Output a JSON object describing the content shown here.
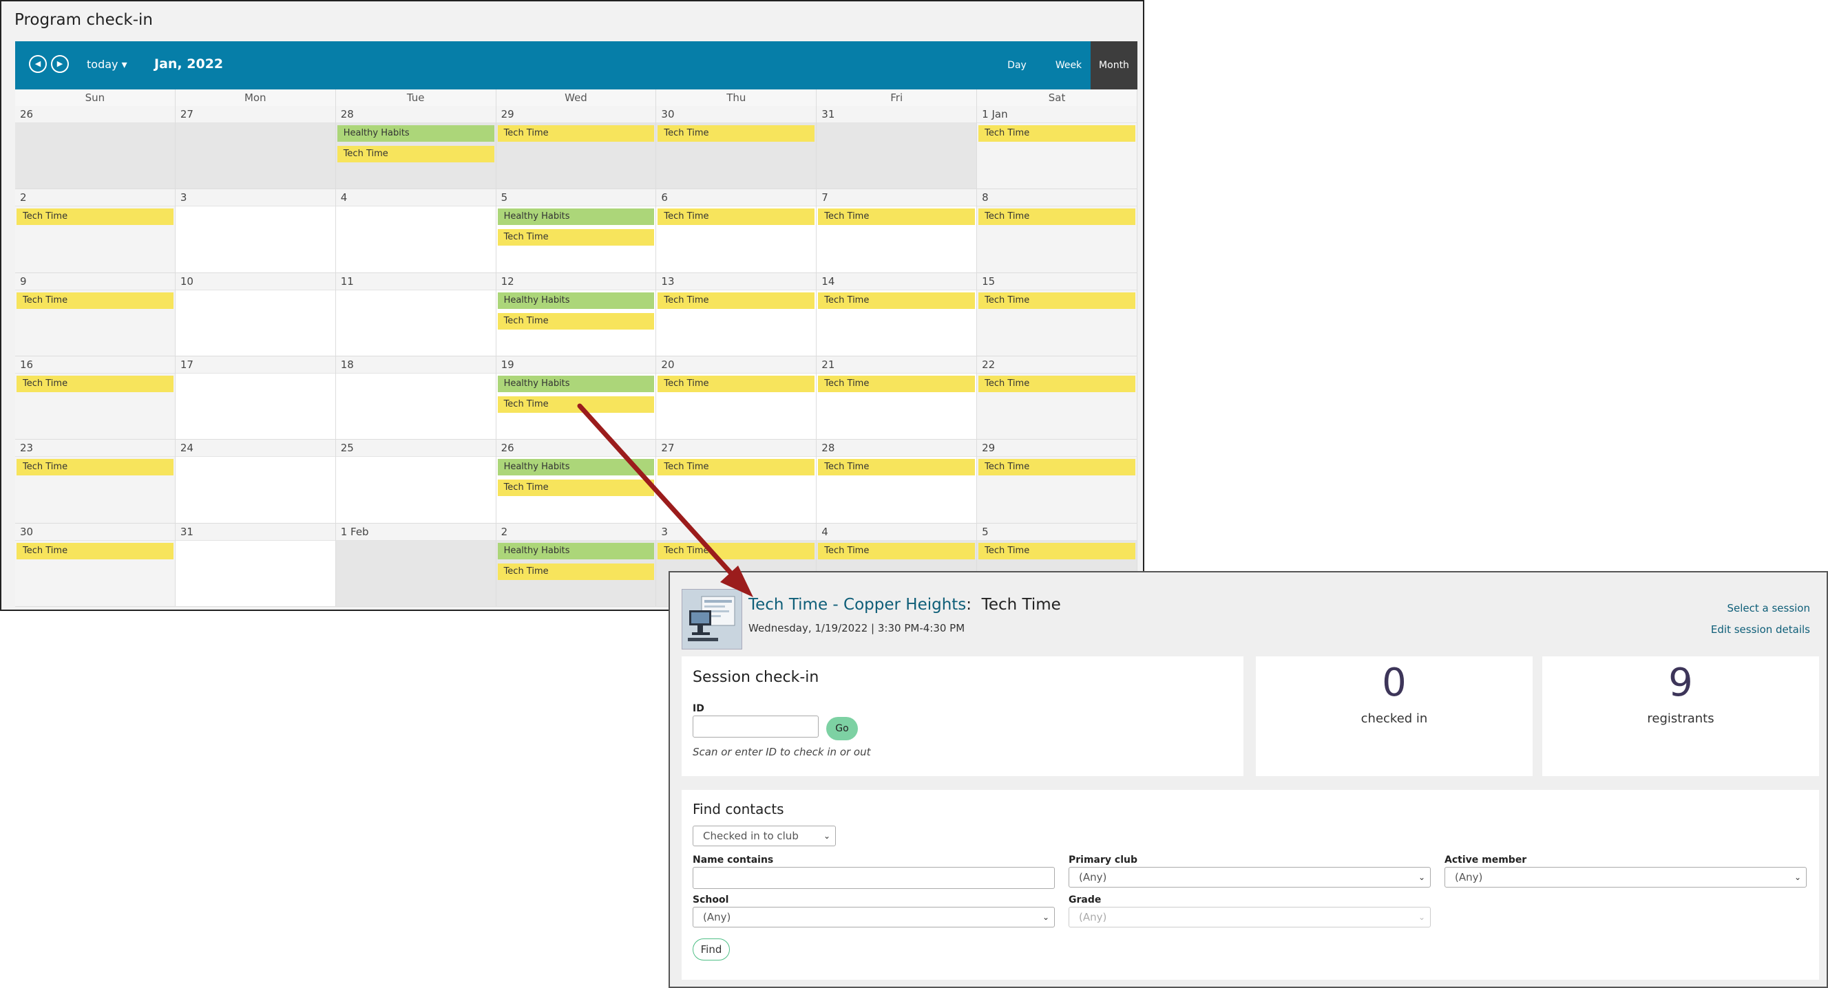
{
  "calendar": {
    "title": "Program check-in",
    "prev_icon": "◀",
    "next_icon": "▶",
    "today_label": "today ▾",
    "month_label": "Jan, 2022",
    "views": {
      "day": "Day",
      "week": "Week",
      "month": "Month"
    },
    "weekdays": [
      "Sun",
      "Mon",
      "Tue",
      "Wed",
      "Thu",
      "Fri",
      "Sat"
    ],
    "weeks": [
      [
        {
          "date": "26",
          "shade": "grey",
          "events": []
        },
        {
          "date": "27",
          "shade": "grey",
          "events": []
        },
        {
          "date": "28",
          "shade": "grey",
          "events": [
            {
              "name": "Healthy Habits",
              "color": "green"
            },
            {
              "name": "Tech Time",
              "color": "yellow"
            }
          ]
        },
        {
          "date": "29",
          "shade": "grey",
          "events": [
            {
              "name": "Tech Time",
              "color": "yellow"
            }
          ]
        },
        {
          "date": "30",
          "shade": "grey",
          "events": [
            {
              "name": "Tech Time",
              "color": "yellow"
            }
          ]
        },
        {
          "date": "31",
          "shade": "grey",
          "events": []
        },
        {
          "date": "1 Jan",
          "shade": "light",
          "events": [
            {
              "name": "Tech Time",
              "color": "yellow"
            }
          ]
        }
      ],
      [
        {
          "date": "2",
          "shade": "light",
          "events": [
            {
              "name": "Tech Time",
              "color": "yellow"
            }
          ]
        },
        {
          "date": "3",
          "shade": "white",
          "events": []
        },
        {
          "date": "4",
          "shade": "white",
          "events": []
        },
        {
          "date": "5",
          "shade": "white",
          "events": [
            {
              "name": "Healthy Habits",
              "color": "green"
            },
            {
              "name": "Tech Time",
              "color": "yellow"
            }
          ]
        },
        {
          "date": "6",
          "shade": "white",
          "events": [
            {
              "name": "Tech Time",
              "color": "yellow"
            }
          ]
        },
        {
          "date": "7",
          "shade": "white",
          "events": [
            {
              "name": "Tech Time",
              "color": "yellow"
            }
          ]
        },
        {
          "date": "8",
          "shade": "light",
          "events": [
            {
              "name": "Tech Time",
              "color": "yellow"
            }
          ]
        }
      ],
      [
        {
          "date": "9",
          "shade": "light",
          "events": [
            {
              "name": "Tech Time",
              "color": "yellow"
            }
          ]
        },
        {
          "date": "10",
          "shade": "white",
          "events": []
        },
        {
          "date": "11",
          "shade": "white",
          "events": []
        },
        {
          "date": "12",
          "shade": "white",
          "events": [
            {
              "name": "Healthy Habits",
              "color": "green"
            },
            {
              "name": "Tech Time",
              "color": "yellow"
            }
          ]
        },
        {
          "date": "13",
          "shade": "white",
          "events": [
            {
              "name": "Tech Time",
              "color": "yellow"
            }
          ]
        },
        {
          "date": "14",
          "shade": "white",
          "events": [
            {
              "name": "Tech Time",
              "color": "yellow"
            }
          ]
        },
        {
          "date": "15",
          "shade": "light",
          "events": [
            {
              "name": "Tech Time",
              "color": "yellow"
            }
          ]
        }
      ],
      [
        {
          "date": "16",
          "shade": "light",
          "events": [
            {
              "name": "Tech Time",
              "color": "yellow"
            }
          ]
        },
        {
          "date": "17",
          "shade": "white",
          "events": []
        },
        {
          "date": "18",
          "shade": "white",
          "events": []
        },
        {
          "date": "19",
          "shade": "white",
          "events": [
            {
              "name": "Healthy Habits",
              "color": "green"
            },
            {
              "name": "Tech Time",
              "color": "yellow"
            }
          ]
        },
        {
          "date": "20",
          "shade": "white",
          "events": [
            {
              "name": "Tech Time",
              "color": "yellow"
            }
          ]
        },
        {
          "date": "21",
          "shade": "white",
          "events": [
            {
              "name": "Tech Time",
              "color": "yellow"
            }
          ]
        },
        {
          "date": "22",
          "shade": "light",
          "events": [
            {
              "name": "Tech Time",
              "color": "yellow"
            }
          ]
        }
      ],
      [
        {
          "date": "23",
          "shade": "light",
          "events": [
            {
              "name": "Tech Time",
              "color": "yellow"
            }
          ]
        },
        {
          "date": "24",
          "shade": "white",
          "events": []
        },
        {
          "date": "25",
          "shade": "white",
          "events": []
        },
        {
          "date": "26",
          "shade": "white",
          "events": [
            {
              "name": "Healthy Habits",
              "color": "green"
            },
            {
              "name": "Tech Time",
              "color": "yellow"
            }
          ]
        },
        {
          "date": "27",
          "shade": "white",
          "events": [
            {
              "name": "Tech Time",
              "color": "yellow"
            }
          ]
        },
        {
          "date": "28",
          "shade": "white",
          "events": [
            {
              "name": "Tech Time",
              "color": "yellow"
            }
          ]
        },
        {
          "date": "29",
          "shade": "light",
          "events": [
            {
              "name": "Tech Time",
              "color": "yellow"
            }
          ]
        }
      ],
      [
        {
          "date": "30",
          "shade": "light",
          "events": [
            {
              "name": "Tech Time",
              "color": "yellow"
            }
          ]
        },
        {
          "date": "31",
          "shade": "white",
          "events": []
        },
        {
          "date": "1 Feb",
          "shade": "grey",
          "events": []
        },
        {
          "date": "2",
          "shade": "grey",
          "events": [
            {
              "name": "Healthy Habits",
              "color": "green"
            },
            {
              "name": "Tech Time",
              "color": "yellow"
            }
          ]
        },
        {
          "date": "3",
          "shade": "grey",
          "events": [
            {
              "name": "Tech Time",
              "color": "yellow"
            }
          ]
        },
        {
          "date": "4",
          "shade": "grey",
          "events": [
            {
              "name": "Tech Time",
              "color": "yellow"
            }
          ]
        },
        {
          "date": "5",
          "shade": "grey",
          "events": [
            {
              "name": "Tech Time",
              "color": "yellow"
            }
          ]
        }
      ]
    ]
  },
  "session": {
    "title_link": "Tech Time - Copper Heights",
    "title_sep": ":",
    "title_name": "Tech Time",
    "date_line": "Wednesday, 1/19/2022 | 3:30 PM-4:30 PM",
    "select_session": "Select a session",
    "edit_details": "Edit session details",
    "checkin": {
      "heading": "Session check-in",
      "id_label": "ID",
      "id_value": "",
      "go_label": "Go",
      "hint": "Scan or enter ID to check in or out"
    },
    "stats": {
      "checked_in": {
        "value": "0",
        "label": "checked in"
      },
      "registrants": {
        "value": "9",
        "label": "registrants"
      }
    },
    "find": {
      "heading": "Find contacts",
      "filter_select": "Checked in to club",
      "name_label": "Name contains",
      "name_value": "",
      "primary_label": "Primary club",
      "primary_value": "(Any)",
      "active_label": "Active member",
      "active_value": "(Any)",
      "school_label": "School",
      "school_value": "(Any)",
      "grade_label": "Grade",
      "grade_value": "(Any)",
      "find_label": "Find"
    }
  },
  "colors": {
    "toolbar": "#067ea8",
    "event_yellow": "#f7e45c",
    "event_green": "#acd679",
    "arrow": "#9b1c1c"
  }
}
